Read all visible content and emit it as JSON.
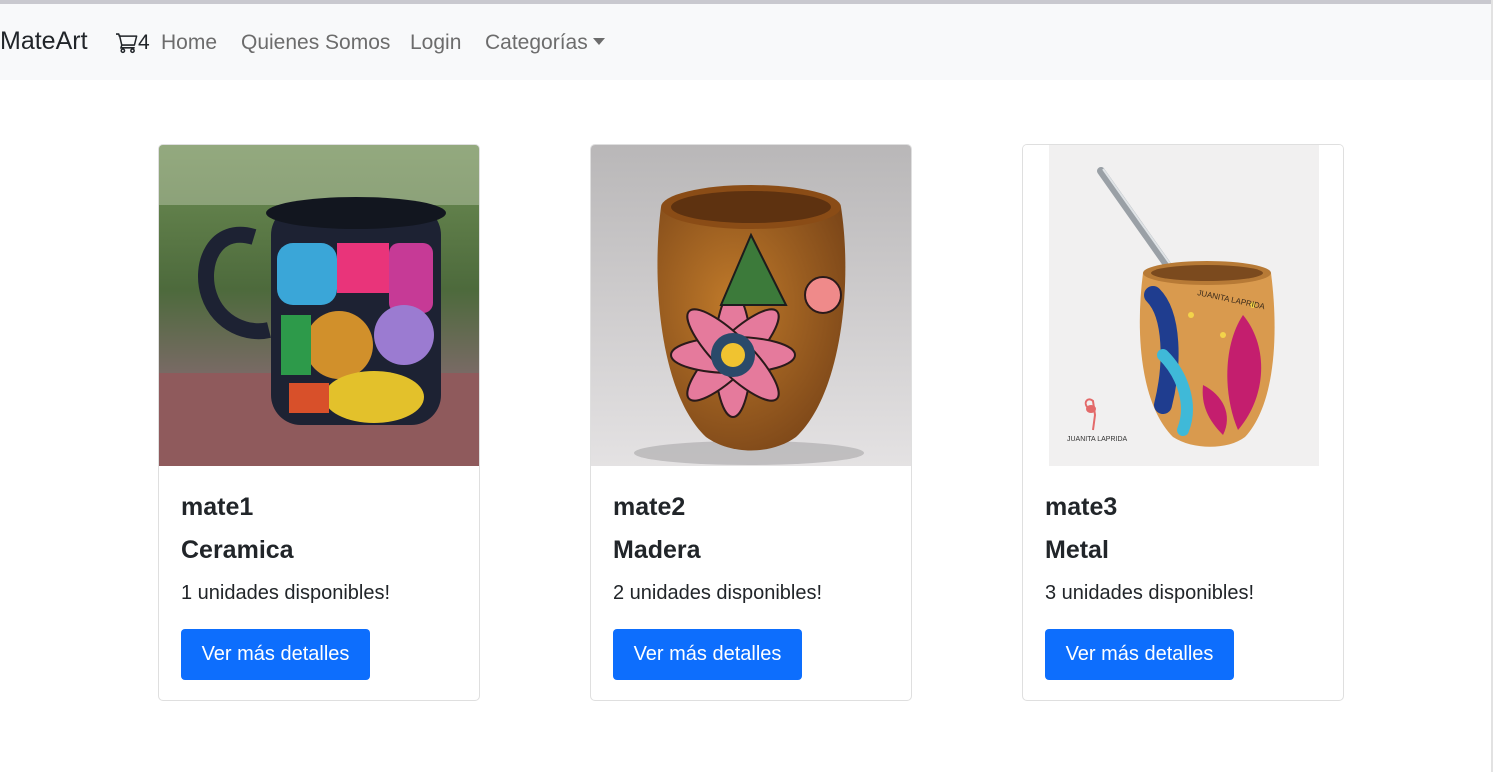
{
  "navbar": {
    "brand": "MateArt",
    "cart_count": "4",
    "links": [
      "Home",
      "Quienes Somos",
      "Login"
    ],
    "dropdown_label": "Categorías",
    "background": "#f8f9fa"
  },
  "products": [
    {
      "name": "mate1",
      "category": "Ceramica",
      "stock_text": "1 unidades disponibles!",
      "button_label": "Ver más detalles",
      "image": "colorful-ceramic-mug-photo"
    },
    {
      "name": "mate2",
      "category": "Madera",
      "stock_text": "2 unidades disponibles!",
      "button_label": "Ver más detalles",
      "image": "painted-wooden-mate-photo"
    },
    {
      "name": "mate3",
      "category": "Metal",
      "stock_text": "3 unidades disponibles!",
      "button_label": "Ver más detalles",
      "image": "painted-mate-with-bombilla-photo",
      "image_watermark": "JUANITA LAPRIDA"
    }
  ],
  "colors": {
    "primary_button": "#0d6efd",
    "text": "#212529",
    "nav_link": "#6c6c6c"
  }
}
